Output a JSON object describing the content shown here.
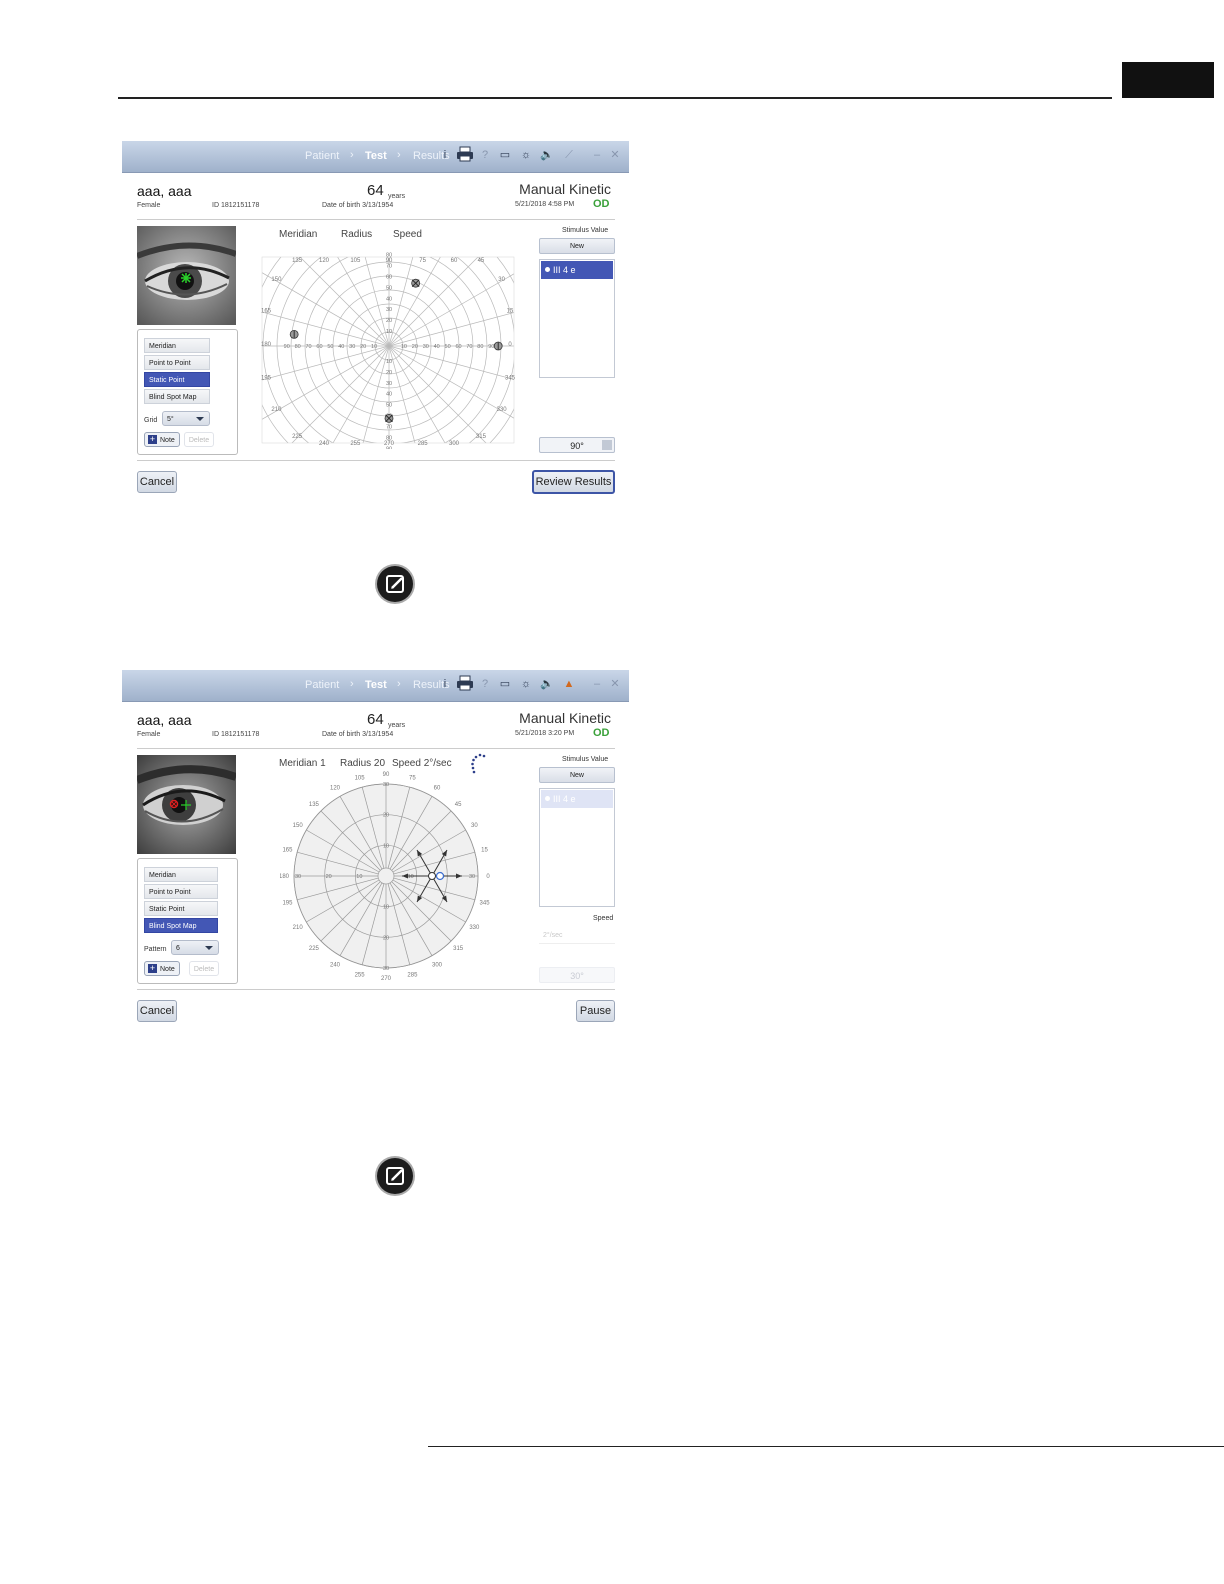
{
  "screens": [
    {
      "nav": {
        "patient": "Patient",
        "test": "Test",
        "results": "Results"
      },
      "patient": {
        "name": "aaa, aaa",
        "sex": "Female",
        "id": "ID 1812151178",
        "age": "64",
        "age_unit": "years",
        "dob": "Date of birth   3/13/1954"
      },
      "test": {
        "name": "Manual Kinetic",
        "datetime": "5/21/2018 4:58 PM",
        "eye": "OD"
      },
      "readout": {
        "meridian": "Meridian",
        "radius": "Radius",
        "speed": "Speed"
      },
      "menu": [
        "Meridian",
        "Point to Point",
        "Static Point",
        "Blind Spot Map"
      ],
      "selected_menu": "Static Point",
      "option_label": "Grid",
      "option_value": "5°",
      "note_label": "Note",
      "delete_label": "Delete",
      "stimulus_title": "Stimulus Value",
      "new_label": "New",
      "stimulus_item": "III 4 e",
      "angle": "90°",
      "cancel_label": "Cancel",
      "action_label": "Review Results",
      "chart": {
        "angle_labels": [
          "90",
          "75",
          "60",
          "45",
          "30",
          "15",
          "0",
          "345",
          "330",
          "315",
          "300",
          "285",
          "270",
          "255",
          "240",
          "225",
          "210",
          "195",
          "180",
          "165",
          "150",
          "135",
          "120",
          "105"
        ],
        "radius_labels": [
          "10",
          "20",
          "30",
          "40",
          "50",
          "60",
          "70",
          "80",
          "90"
        ],
        "markers": [
          {
            "meridian": 67,
            "radius": 50,
            "type": "x"
          },
          {
            "meridian": 173,
            "radius": 70,
            "type": "o"
          },
          {
            "meridian": 0,
            "radius": 80,
            "type": "o"
          },
          {
            "meridian": 270,
            "radius": 53,
            "type": "x"
          }
        ]
      }
    },
    {
      "nav": {
        "patient": "Patient",
        "test": "Test",
        "results": "Results"
      },
      "patient": {
        "name": "aaa, aaa",
        "sex": "Female",
        "id": "ID 1812151178",
        "age": "64",
        "age_unit": "years",
        "dob": "Date of birth   3/13/1954"
      },
      "test": {
        "name": "Manual Kinetic",
        "datetime": "5/21/2018 3:20 PM",
        "eye": "OD"
      },
      "readout": {
        "meridian": "Meridian 1",
        "radius": "Radius 20",
        "speed": "Speed 2°/sec"
      },
      "menu": [
        "Meridian",
        "Point to Point",
        "Static Point",
        "Blind Spot Map"
      ],
      "selected_menu": "Blind Spot Map",
      "option_label": "Pattern",
      "option_value": "6",
      "note_label": "Note",
      "delete_label": "Delete",
      "stimulus_title": "Stimulus Value",
      "new_label": "New",
      "stimulus_item": "III 4 e",
      "speed_label": "Speed",
      "speed_value": "2°/sec",
      "angle": "30°",
      "cancel_label": "Cancel",
      "action_label": "Pause",
      "chart": {
        "angle_labels": [
          "90",
          "75",
          "60",
          "45",
          "30",
          "15",
          "0",
          "345",
          "330",
          "315",
          "300",
          "285",
          "270",
          "255",
          "240",
          "225",
          "210",
          "195",
          "180",
          "165",
          "150",
          "135",
          "120",
          "105"
        ],
        "radius_labels": [
          "10",
          "20",
          "30"
        ],
        "blind_spot_center": {
          "meridian": 0,
          "radius": 15
        },
        "arrows": 6
      }
    }
  ]
}
